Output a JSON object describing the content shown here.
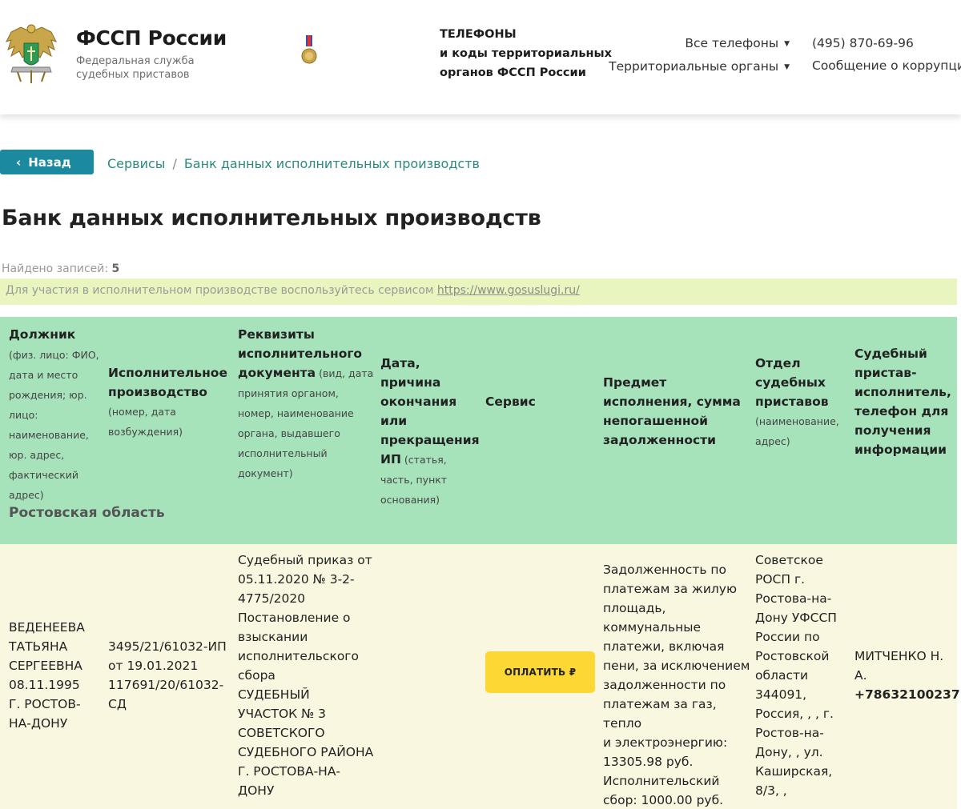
{
  "header": {
    "brand_title": "ФССП России",
    "brand_subtitle": "Федеральная служба судебных приставов",
    "phones_heading": [
      "ТЕЛЕФОНЫ",
      "и коды территориальных",
      "органов ФССП России"
    ],
    "nav": {
      "all_phones": "Все телефоны",
      "territorial": "Территориальные органы"
    },
    "phone": "(495) 870-69-96",
    "corruption": "Сообщение о коррупции"
  },
  "back_button": "Назад",
  "breadcrumb": {
    "item1": "Сервисы",
    "separator": "/",
    "item2": "Банк данных исполнительных производств"
  },
  "page_title": "Банк данных исполнительных производств",
  "found": {
    "label": "Найдено записей:",
    "count": "5"
  },
  "notice": {
    "text": "Для участия в исполнительном производстве воспользуйтесь сервисом ",
    "link": "https://www.gosuslugi.ru/"
  },
  "table": {
    "headers": {
      "debtor_bold": "Должник",
      "debtor_small": " (физ. лицо: ФИО, дата и место рождения; юр. лицо: наименование, юр. адрес, фактический адрес)",
      "proceeding_bold": "Исполнительное производство",
      "proceeding_small": "(номер, дата возбуждения)",
      "document_bold": "Реквизиты исполнительного документа",
      "document_small": " (вид, дата принятия органом, номер, наименование органа, выдавшего исполнительный документ)",
      "end_bold": "Дата, причина окончания или прекращения ИП",
      "end_small": " (статья, часть, пункт основания)",
      "service": "Сервис",
      "subject": "Предмет исполнения, сумма непогашенной задолженности",
      "department_bold": "Отдел судебных приставов",
      "department_small": "(наименование, адрес)",
      "bailiff": "Судебный пристав-исполнитель, телефон для получения информации"
    },
    "region": "Ростовская область",
    "rows": [
      {
        "debtor": [
          "ВЕДЕНЕЕВА",
          "ТАТЬЯНА",
          "СЕРГЕЕВНА",
          "08.11.1995",
          "Г. РОСТОВ-",
          "НА-ДОНУ"
        ],
        "proceeding": [
          "3495/21/61032-ИП",
          "от 19.01.2021",
          "117691/20/61032-",
          "СД"
        ],
        "document": [
          "Судебный приказ от",
          "05.11.2020 № 3-2-",
          "4775/2020",
          "Постановление о",
          "взыскании",
          "исполнительского",
          "сбора",
          "СУДЕБНЫЙ",
          "УЧАСТОК № 3",
          "СОВЕТСКОГО",
          "СУДЕБНОГО РАЙОНА",
          "Г. РОСТОВА-НА-",
          "ДОНУ"
        ],
        "pay_button": "ОПЛАТИТЬ ₽",
        "subject": [
          "Задолженность по",
          "платежам за жилую",
          "площадь,",
          "коммунальные",
          "платежи, включая",
          "пени, за исключением",
          "задолженности по",
          "платежам за газ, тепло",
          "и электроэнергию:",
          "13305.98 руб.",
          "Исполнительский",
          "сбор: 1000.00 руб."
        ],
        "department": [
          "Советское",
          "РОСП г.",
          "Ростова-на-",
          "Дону УФССП",
          "России по",
          "Ростовской",
          "области",
          "344091,",
          "Россия, , , г.",
          "Ростов-на-",
          "Дону, , ул.",
          "Каширская,",
          "8/3, ,"
        ],
        "bailiff_name": [
          "МИТЧЕНКО Н.",
          "А."
        ],
        "bailiff_phone": "+78632100237"
      }
    ]
  }
}
